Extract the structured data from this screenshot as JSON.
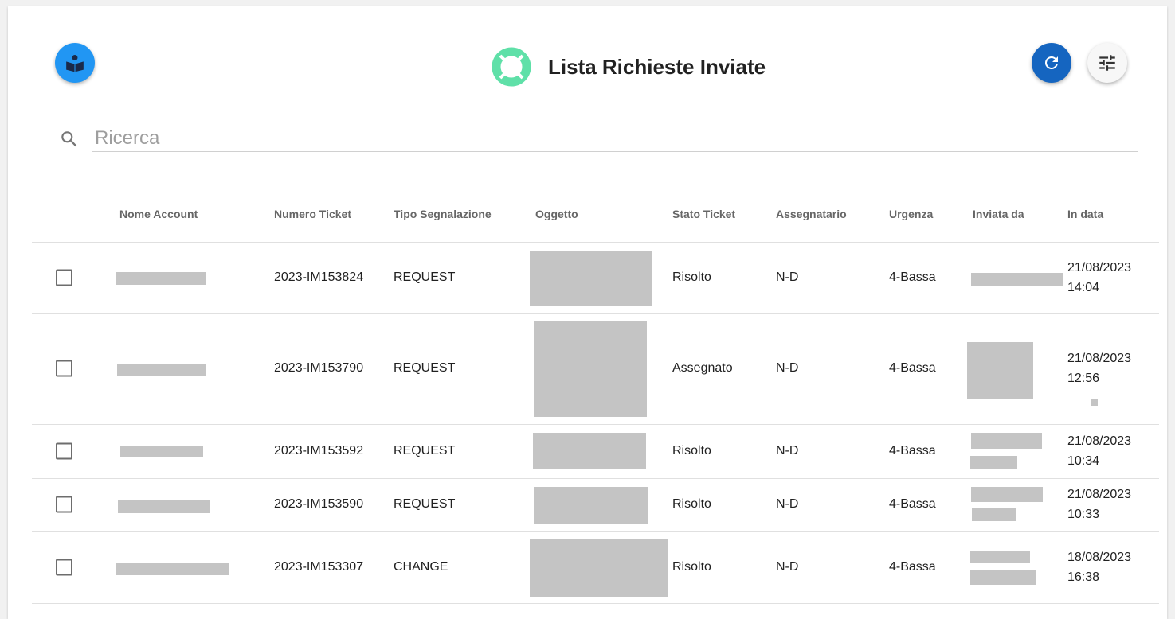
{
  "header": {
    "title": "Lista Richieste Inviate",
    "help_icon": "book-reader-icon",
    "title_icon": "lifebuoy-icon",
    "refresh_icon": "refresh-icon",
    "filter_icon": "tune-sliders-icon"
  },
  "search": {
    "placeholder": "Ricerca",
    "value": "",
    "icon": "search-icon"
  },
  "table": {
    "columns": [
      "Nome Account",
      "Numero Ticket",
      "Tipo Segnalazione",
      "Oggetto",
      "Stato Ticket",
      "Assegnatario",
      "Urgenza",
      "Inviata da",
      "In data"
    ],
    "rows": [
      {
        "ticket": "2023-IM153824",
        "tipo": "REQUEST",
        "stato": "Risolto",
        "assegnatario": "N-D",
        "urgenza": "4-Bassa",
        "date": "21/08/2023",
        "time": "14:04"
      },
      {
        "ticket": "2023-IM153790",
        "tipo": "REQUEST",
        "stato": "Assegnato",
        "assegnatario": "N-D",
        "urgenza": "4-Bassa",
        "date": "21/08/2023",
        "time": "12:56"
      },
      {
        "ticket": "2023-IM153592",
        "tipo": "REQUEST",
        "stato": "Risolto",
        "assegnatario": "N-D",
        "urgenza": "4-Bassa",
        "date": "21/08/2023",
        "time": "10:34"
      },
      {
        "ticket": "2023-IM153590",
        "tipo": "REQUEST",
        "stato": "Risolto",
        "assegnatario": "N-D",
        "urgenza": "4-Bassa",
        "date": "21/08/2023",
        "time": "10:33"
      },
      {
        "ticket": "2023-IM153307",
        "tipo": "CHANGE",
        "stato": "Risolto",
        "assegnatario": "N-D",
        "urgenza": "4-Bassa",
        "date": "18/08/2023",
        "time": "16:38"
      }
    ]
  },
  "colors": {
    "help_fab": "#2196f3",
    "refresh_fab": "#1565c0",
    "title_icon": "#5fe0a8",
    "redaction": "#c4c4c4"
  }
}
